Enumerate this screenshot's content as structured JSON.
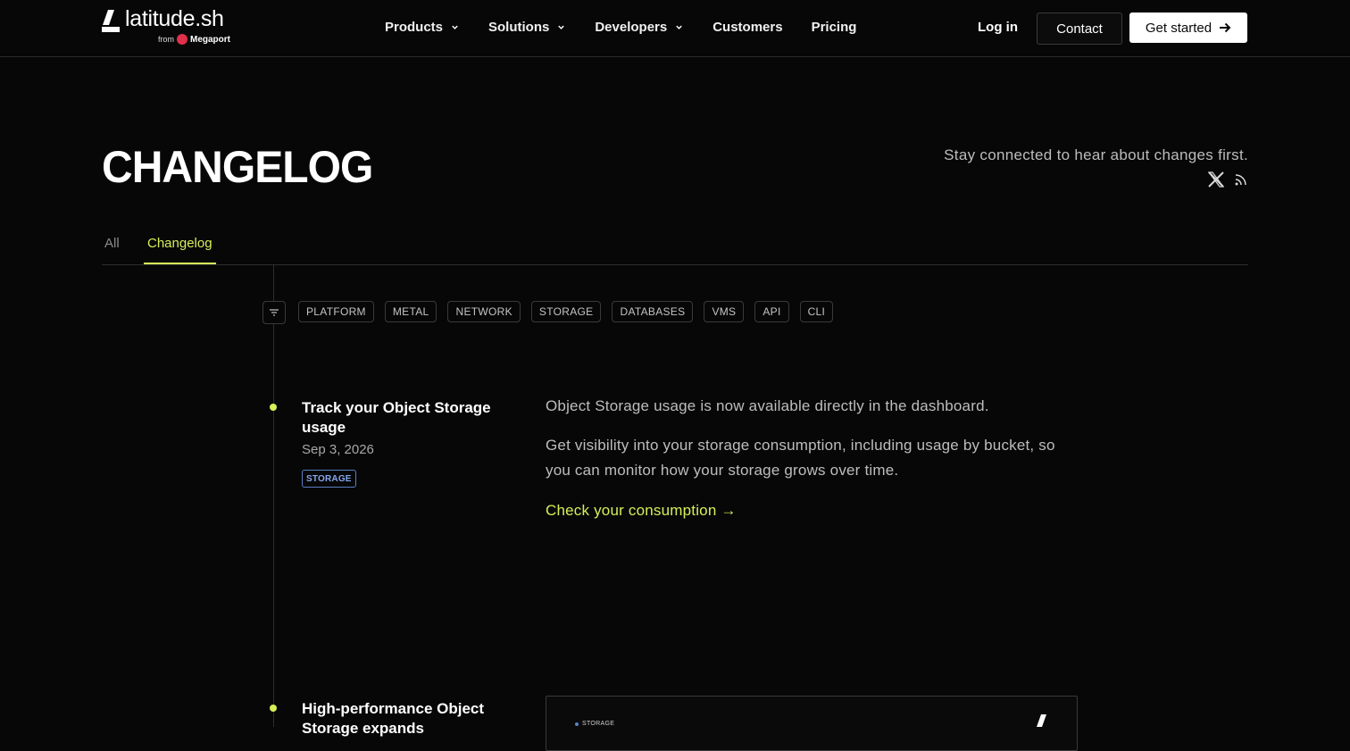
{
  "brand": {
    "name": "latitude.sh",
    "from_label": "from",
    "partner": "Megaport"
  },
  "nav": {
    "items": [
      {
        "label": "Products",
        "dropdown": true
      },
      {
        "label": "Solutions",
        "dropdown": true
      },
      {
        "label": "Developers",
        "dropdown": true
      },
      {
        "label": "Customers",
        "dropdown": false
      },
      {
        "label": "Pricing",
        "dropdown": false
      }
    ],
    "login": "Log in",
    "contact": "Contact",
    "get_started": "Get started"
  },
  "header": {
    "title": "CHANGELOG",
    "stay_connected": "Stay connected to hear about changes first.",
    "social_icons": [
      "x-icon",
      "rss-icon"
    ]
  },
  "tabs": {
    "all": "All",
    "changelog": "Changelog",
    "active": "Changelog"
  },
  "filters": {
    "chips": [
      "PLATFORM",
      "METAL",
      "NETWORK",
      "STORAGE",
      "DATABASES",
      "VMS",
      "API",
      "CLI"
    ]
  },
  "entries": [
    {
      "title": "Track your Object Storage usage",
      "date": "Sep 3, 2026",
      "tag": "STORAGE",
      "paragraphs": [
        "Object Storage usage is now available directly in the dashboard.",
        "Get visibility into your storage consumption, including usage by bucket, so you can monitor how your storage grows over time."
      ],
      "cta": "Check your consumption →"
    },
    {
      "title": "High-performance Object Storage expands",
      "preview_label": "STORAGE"
    }
  ],
  "colors": {
    "background": "#070707",
    "accent": "#d8ee5a",
    "tag_blue": "#86a8ef"
  }
}
